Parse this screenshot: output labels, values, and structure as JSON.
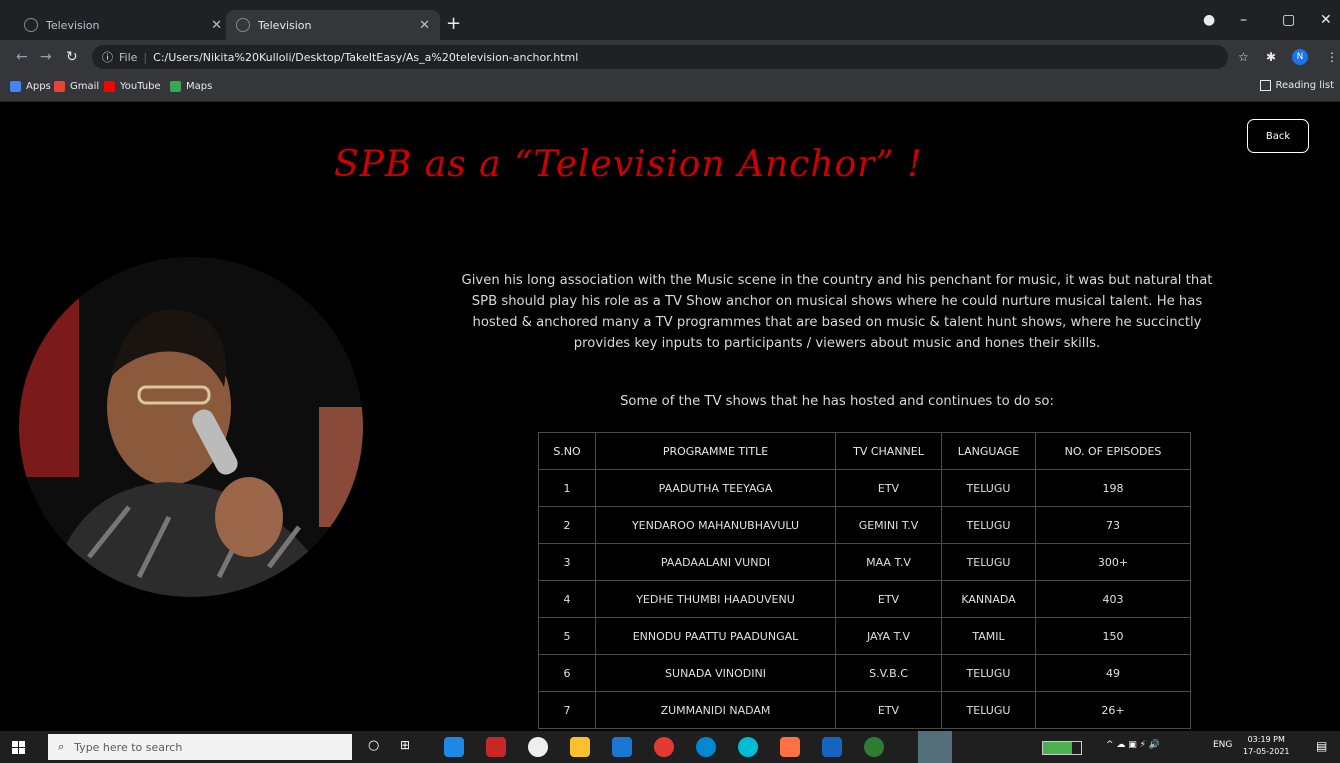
{
  "browser": {
    "tabs": [
      {
        "title": "Television",
        "active": false
      },
      {
        "title": "Television",
        "active": true
      }
    ],
    "new_tab": "+",
    "window_controls": {
      "minimize": "–",
      "maximize": "▢",
      "close": "✕"
    },
    "url_label": "File",
    "url": "C:/Users/Nikita%20Kulloli/Desktop/TakeItEasy/As_a%20television-anchor.html",
    "bookmarks": [
      "Apps",
      "Gmail",
      "YouTube",
      "Maps"
    ],
    "reading_list": "Reading list",
    "profile_initial": "N"
  },
  "page": {
    "heading": "SPB as a “Television Anchor” !",
    "back_button": "Back",
    "intro": "Given his long association with the Music scene in the country and his penchant for music, it was but natural that SPB should play his role as a TV Show anchor on musical shows where he could nurture musical talent. He has hosted & anchored many a TV programmes that are based on music & talent hunt shows, where he succinctly provides key inputs to participants / viewers about music and hones their skills.",
    "subintro": "Some of the TV shows that he has hosted and continues to do so:",
    "table": {
      "headers": [
        "S.NO",
        "PROGRAMME TITLE",
        "TV CHANNEL",
        "LANGUAGE",
        "NO. OF EPISODES"
      ],
      "rows": [
        [
          "1",
          "PAADUTHA TEEYAGA",
          "ETV",
          "TELUGU",
          "198"
        ],
        [
          "2",
          "YENDAROO MAHANUBHAVULU",
          "GEMINI T.V",
          "TELUGU",
          "73"
        ],
        [
          "3",
          "PAADAALANI VUNDI",
          "MAA T.V",
          "TELUGU",
          "300+"
        ],
        [
          "4",
          "YEDHE THUMBI HAADUVENU",
          "ETV",
          "KANNADA",
          "403"
        ],
        [
          "5",
          "ENNODU PAATTU PAADUNGAL",
          "JAYA T.V",
          "TAMIL",
          "150"
        ],
        [
          "6",
          "SUNADA VINODINI",
          "S.V.B.C",
          "TELUGU",
          "49"
        ],
        [
          "7",
          "ZUMMANIDI NADAM",
          "ETV",
          "TELUGU",
          "26+"
        ]
      ]
    }
  },
  "taskbar": {
    "search_placeholder": "Type here to search",
    "battery": "77%",
    "lang": "ENG",
    "time": "03:19 PM",
    "date": "17-05-2021"
  },
  "colors": {
    "heading": "#cc0000",
    "background": "#000000",
    "chrome_dark": "#202124",
    "chrome_mid": "#35363a"
  }
}
